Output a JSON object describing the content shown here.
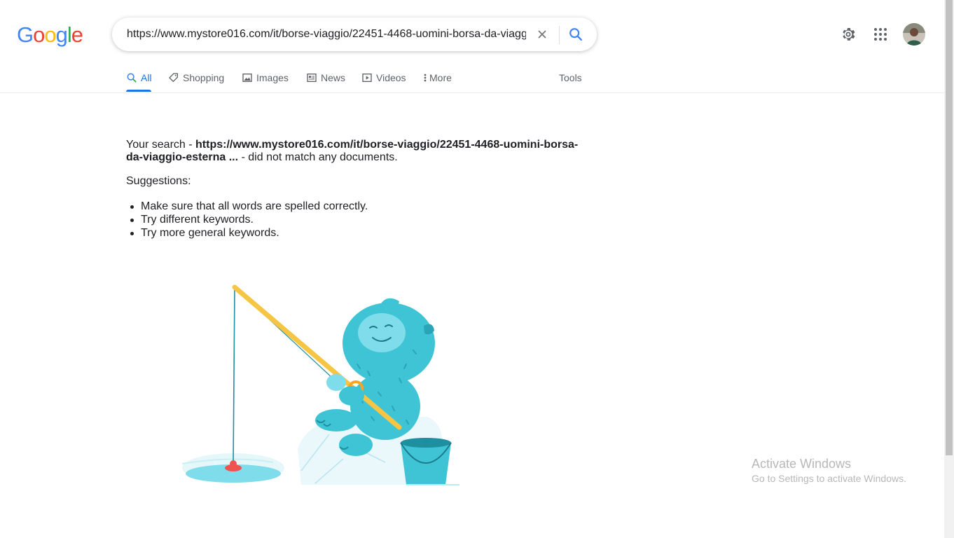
{
  "logo": {
    "letters": [
      "G",
      "o",
      "o",
      "g",
      "l",
      "e"
    ],
    "colors": [
      "#4285F4",
      "#EA4335",
      "#FBBC05",
      "#4285F4",
      "#34A853",
      "#EA4335"
    ]
  },
  "search": {
    "value": "https://www.mystore016.com/it/borse-viaggio/22451-4468-uomini-borsa-da-viaggio-esterna"
  },
  "tabs": [
    {
      "label": "All",
      "icon": "search-icon",
      "active": true
    },
    {
      "label": "Shopping",
      "icon": "tag-icon"
    },
    {
      "label": "Images",
      "icon": "image-icon"
    },
    {
      "label": "News",
      "icon": "news-icon"
    },
    {
      "label": "Videos",
      "icon": "video-icon"
    },
    {
      "label": "More",
      "icon": "more-vert-icon"
    },
    {
      "label": "Tools"
    }
  ],
  "result": {
    "prefix": "Your search - ",
    "query": "https://www.mystore016.com/it/borse-viaggio/22451-4468-uomini-borsa-da-viaggio-esterna ...",
    "suffix": " - did not match any documents.",
    "suggestions_title": "Suggestions:",
    "suggestions": [
      "Make sure that all words are spelled correctly.",
      "Try different keywords.",
      "Try more general keywords."
    ]
  },
  "watermark": {
    "title": "Activate Windows",
    "subtitle": "Go to Settings to activate Windows."
  },
  "colors": {
    "accent": "#1a73e8",
    "text": "#202124",
    "muted": "#5f6368"
  }
}
